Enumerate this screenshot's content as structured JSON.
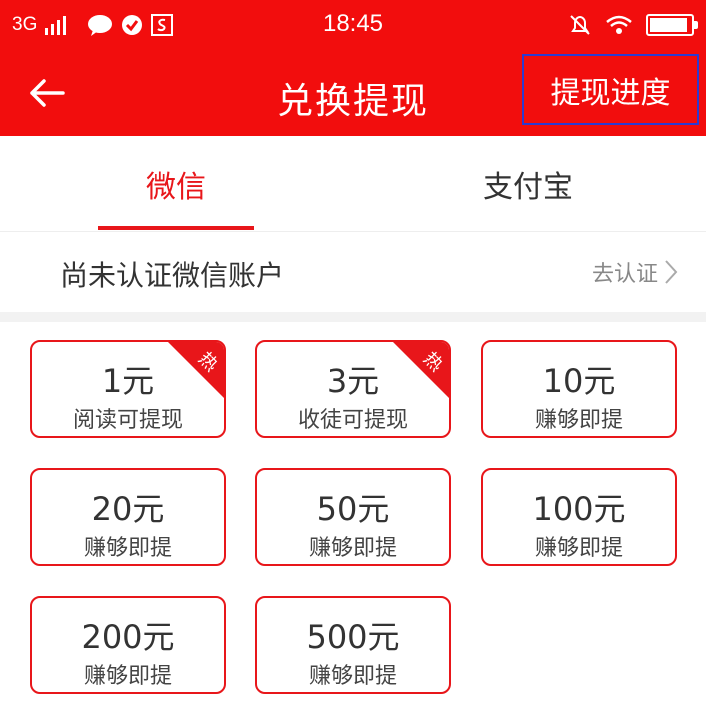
{
  "status_bar": {
    "network": "3G",
    "time": "18:45",
    "battery_level": 0.93
  },
  "app_bar": {
    "title": "兑换提现",
    "progress_label": "提现进度"
  },
  "tabs": [
    {
      "label": "微信",
      "active": true
    },
    {
      "label": "支付宝",
      "active": false
    }
  ],
  "verify": {
    "text": "尚未认证微信账户",
    "link": "去认证"
  },
  "options": [
    {
      "amount": "1元",
      "sub": "阅读可提现",
      "hot": "热"
    },
    {
      "amount": "3元",
      "sub": "收徒可提现",
      "hot": "热"
    },
    {
      "amount": "10元",
      "sub": "赚够即提"
    },
    {
      "amount": "20元",
      "sub": "赚够即提"
    },
    {
      "amount": "50元",
      "sub": "赚够即提"
    },
    {
      "amount": "100元",
      "sub": "赚够即提"
    },
    {
      "amount": "200元",
      "sub": "赚够即提"
    },
    {
      "amount": "500元",
      "sub": "赚够即提"
    }
  ],
  "colors": {
    "brand_red": "#f20d0d",
    "accent_red": "#e8161a",
    "highlight_border": "#2b3bd1"
  }
}
